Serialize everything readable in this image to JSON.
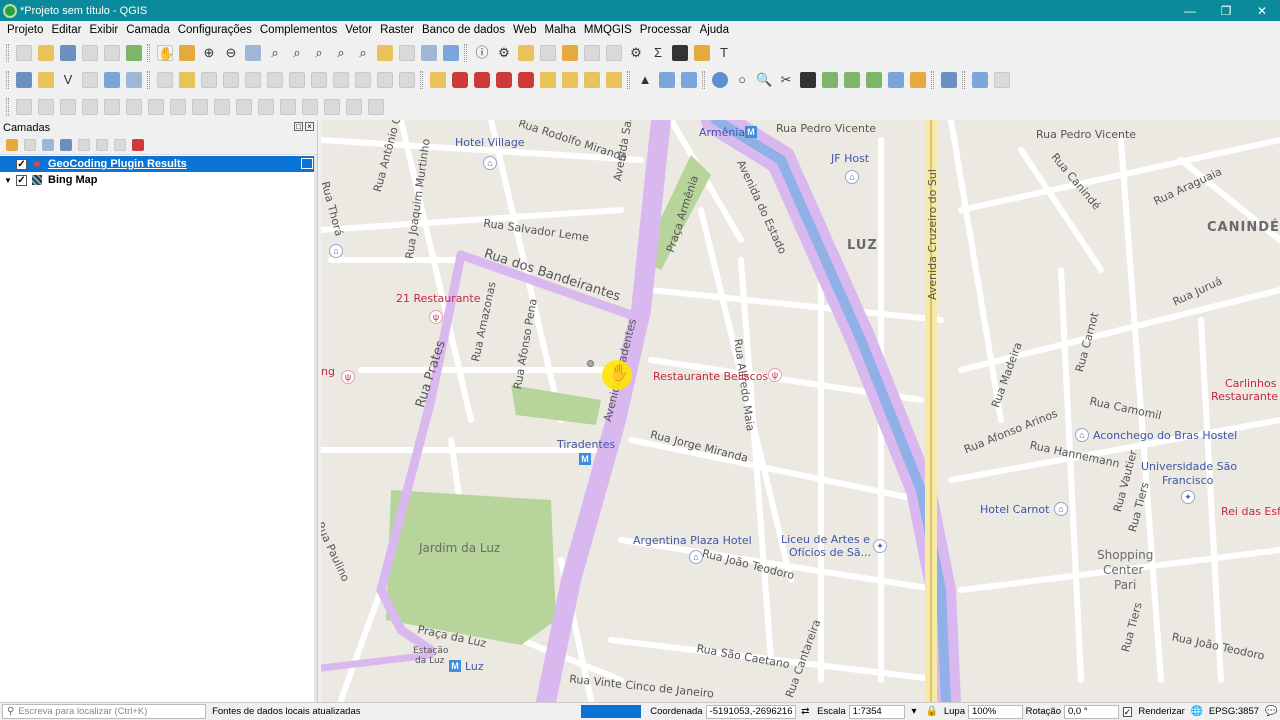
{
  "window": {
    "title": "*Projeto sem título - QGIS",
    "controls": [
      "—",
      "❐",
      "✕"
    ]
  },
  "menu": [
    "Projeto",
    "Editar",
    "Exibir",
    "Camada",
    "Configurações",
    "Complementos",
    "Vetor",
    "Raster",
    "Banco de dados",
    "Web",
    "Malha",
    "MMQGIS",
    "Processar",
    "Ajuda"
  ],
  "layers_panel": {
    "title": "Camadas",
    "layers": [
      {
        "name": "GeoCoding Plugin Results",
        "checked": true,
        "selected": true,
        "symbol": "point"
      },
      {
        "name": "Bing Map",
        "checked": true,
        "selected": false,
        "symbol": "raster"
      }
    ]
  },
  "map": {
    "streets": {
      "rua_rodolfo_miranda": "Rua Rodolfo Miranda",
      "avenida_santos_dumont": "Avenida Santos Dum",
      "armenia": "Armênia",
      "rua_pedro_vicente_1": "Rua Pedro Vicente",
      "rua_pedro_vicente_2": "Rua Pedro Vicente",
      "avenida_do_estado": "Avenida do Estado",
      "rua_antonio_coruja": "Rua Antônio Coruja",
      "rua_joaquim_murtinho": "Rua Joaquim Murtinho",
      "rua_salvador_leme": "Rua Salvador Leme",
      "praca_armenia": "Praça Armênia",
      "rua_dos_bandeirantes": "Rua dos Bandeirantes",
      "rua_alfredo_maia": "Rua Alfredo Maia",
      "avenida_cruzeiro_do_sul": "Avenida Cruzeiro do Sul",
      "rua_caninde": "Rua Canindé",
      "rua_araguaia": "Rua Araguaia",
      "rua_jurua": "Rua Juruá",
      "rua_prates": "Rua Prates",
      "rua_amazonas": "Rua Amazonas",
      "rua_afonso_pena": "Rua Afonso Pena",
      "avenida_tiradentes": "Avenida Tiradentes",
      "rua_jorge_miranda": "Rua Jorge Miranda",
      "rua_madeira": "Rua Madeira",
      "rua_carnot": "Rua Carnot",
      "rua_camomil": "Rua Camomil",
      "rua_afonso_arinos": "Rua Afonso Arinos",
      "rua_hannemann": "Rua Hannemann",
      "rua_joao_teodoro_1": "Rua João Teodoro",
      "rua_joao_teodoro_2": "Rua João Teodoro",
      "rua_sao_caetano": "Rua São Caetano",
      "rua_vinte_cinco_de_janeiro": "Rua Vinte Cinco de Janeiro",
      "praca_da_luz": "Praça da Luz",
      "rua_vautier": "Rua Vautier",
      "rua_tiers_1": "Rua Tiers",
      "rua_tiers_2": "Rua Tiers",
      "rua_paulino": "Rua Paulino",
      "rua_cantareira": "Rua Cantareira",
      "rua_thora": "Rua Thorá"
    },
    "places": {
      "hotel_village": "Hotel Village",
      "jf_host": "JF Host",
      "luz": "LUZ",
      "caninde": "CANINDÉ",
      "restaurante_21": "21 Restaurante",
      "restaurante_beliscos": "Restaurante Beliscos",
      "carlinhos_1": "Carlinhos",
      "carlinhos_2": "Restaurante",
      "ng": "ng",
      "tiradentes": "Tiradentes",
      "aconchego": "Aconchego do Bras Hostel",
      "universidade_1": "Universidade São",
      "universidade_2": "Francisco",
      "rei_das_esfihas": "Rei das Esfiha",
      "hotel_carnot": "Hotel Carnot",
      "jardim_da_luz": "Jardim da Luz",
      "argentina_plaza": "Argentina Plaza Hotel",
      "liceu_1": "Liceu de Artes e",
      "liceu_2": "Ofícios de Sã...",
      "shopping_1": "Shopping",
      "shopping_2": "Center",
      "shopping_3": "Pari",
      "estacao_1": "Estação",
      "estacao_2": "da Luz",
      "luz_station": "Luz"
    }
  },
  "statusbar": {
    "locator_placeholder": "Escreva para localizar (Ctrl+K)",
    "message": "Fontes de dados locais atualizadas",
    "coord_label": "Coordenada",
    "coord_value": "-5191053,-2696216",
    "scale_label": "Escala",
    "scale_value": "1:7354",
    "magnifier_label": "Lupa",
    "magnifier_value": "100%",
    "rotation_label": "Rotação",
    "rotation_value": "0,0 °",
    "render_label": "Renderizar",
    "crs_value": "EPSG:3857"
  },
  "colors": {
    "titlebar": "#0b8a9b",
    "selection": "#0a74d6",
    "major_road": "#d9b8f0",
    "park": "#b7d49a",
    "water_road": "#8fb1e8"
  }
}
